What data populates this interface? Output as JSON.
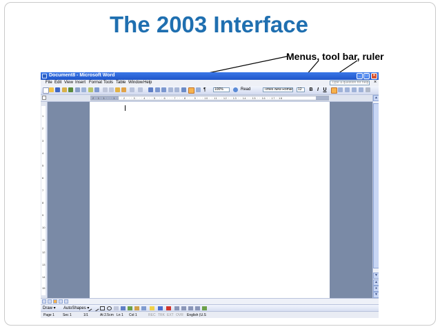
{
  "slide": {
    "title": "The 2003 Interface",
    "callout": "Menus, tool bar, ruler"
  },
  "word": {
    "window_title": "Document8 - Microsoft Word",
    "menus": [
      "File",
      "Edit",
      "View",
      "Insert",
      "Format",
      "Tools",
      "Table",
      "Window",
      "Help"
    ],
    "question_placeholder": "Type a question for help",
    "toolbar": {
      "zoom": "100%",
      "read": "Read",
      "font": "Times New Roman",
      "size": "12",
      "bold": "B",
      "italic": "I",
      "underline": "U"
    },
    "ruler": "2 · 1 · 1 · · · 1 · · · 2 · · · 3 · · · 4 · · · 5 · · · 6 · · · 7 · · · 8 · · · 9 · · · 10 · · 11 · · 12 · · 13 · · 14 · · 15 · · 16 · · 17 · 18",
    "vruler": [
      "1",
      "2",
      "3",
      "4",
      "5",
      "6",
      "7",
      "8",
      "9",
      "10",
      "11",
      "12",
      "13",
      "14",
      "15"
    ],
    "drawbar": {
      "draw": "Draw ▾",
      "autoshapes": "AutoShapes ▾"
    },
    "status": {
      "page": "Page 1",
      "sec": "Sec 1",
      "pages": "1/1",
      "at": "At 2.5cm",
      "ln": "Ln 1",
      "col": "Col 1",
      "rec": "REC",
      "trk": "TRK",
      "ext": "EXT",
      "ovr": "OVR",
      "lang": "English (U.S"
    }
  },
  "colors": {
    "title_blue": "#1f6fb0",
    "xp_title": "#2558d0",
    "app_bg": "#7a8aa6"
  }
}
